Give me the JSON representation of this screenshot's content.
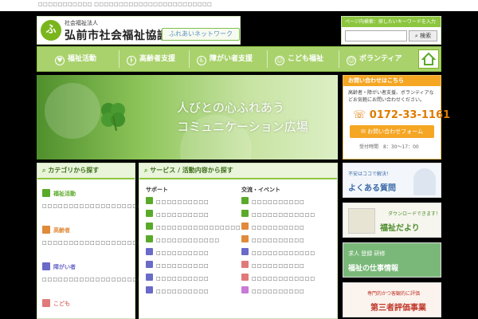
{
  "top_strip": {
    "text": "□□□□□□□□□□□ □□□□□□□□□□□□□□□□□□□□□□□□"
  },
  "header": {
    "logo_sub": "社会福祉法人",
    "logo_main": "弘前市社会福祉協議会",
    "logo_tag": "ふれあいネットワーク",
    "search_caption": "ページ内検索：探したいキーワードを入力",
    "search_placeholder": "",
    "search_button": "検索"
  },
  "nav": {
    "items": [
      {
        "label": "福祉活動",
        "icon": "heart-icon"
      },
      {
        "label": "高齢者支援",
        "icon": "elderly-icon"
      },
      {
        "label": "障がい者支援",
        "icon": "wheelchair-icon"
      },
      {
        "label": "こども福祉",
        "icon": "children-icon"
      },
      {
        "label": "ボランティア",
        "icon": "smile-icon"
      }
    ],
    "home_icon": "home-icon"
  },
  "hero": {
    "line1": "人びとの心ふれあう",
    "line2": "コミュニケーション広場"
  },
  "contact": {
    "title": "お問い合わせはこちら",
    "text": "高齢者・障がい者支援、ボランティアなどお気軽にお問い合わせください。",
    "phone": "0172-33-1161",
    "button": "お問い合わせフォーム",
    "hours": "受付時間　8：30～17：00"
  },
  "categories": {
    "title": "カテゴリから探す",
    "items": [
      {
        "label": "福祉活動",
        "color": "#5aaa2a",
        "desc": "□□□□□□□□□□□□□□□□□□□□□□□□□□□□□□□□"
      },
      {
        "label": "高齢者",
        "color": "#e08a3a",
        "desc": "□□□□□□□□□□□□□□□□□□□□□□□□□□□□□□□□"
      },
      {
        "label": "障がい者",
        "color": "#6a6ac8",
        "desc": "□□□□□□□□□□□□□□□□□□□□□□□□□□□□□□□□"
      },
      {
        "label": "こども",
        "color": "#e07a7a",
        "desc": "□□□□□□□□□□□□□□□□"
      }
    ]
  },
  "services": {
    "title": "サービス / 活動内容から探す",
    "col1_title": "サポート",
    "col2_title": "交流・イベント",
    "col1": [
      {
        "text": "□□□□□□□□□□",
        "color": "#5aaa2a"
      },
      {
        "text": "□□□□□□□□□□",
        "color": "#5aaa2a"
      },
      {
        "text": "□□□□□□□□□□□□□□□□",
        "color": "#5aaa2a"
      },
      {
        "text": "□□□□□□□□□□□□",
        "color": "#5aaa2a"
      },
      {
        "text": "□□□□□□□□□□",
        "color": "#6a6ac8"
      },
      {
        "text": "□□□□□□□□□□",
        "color": "#6a6ac8"
      },
      {
        "text": "□□□□□□□□□□",
        "color": "#6a6ac8"
      },
      {
        "text": "□□□□□□□□□□",
        "color": "#6a6ac8"
      }
    ],
    "col2": [
      {
        "text": "□□□□□□□□□□",
        "color": "#5aaa2a"
      },
      {
        "text": "□□□□□□□□□□□□",
        "color": "#5aaa2a"
      },
      {
        "text": "□□□□□□□□□□",
        "color": "#e08a3a"
      },
      {
        "text": "□□□□□□□□□□",
        "color": "#e08a3a"
      },
      {
        "text": "□□□□□□□□□□□□",
        "color": "#6a6ac8"
      },
      {
        "text": "□□□□□□□□□□",
        "color": "#e07a7a"
      },
      {
        "text": "□□□□□□□□□□□□",
        "color": "#e07a7a"
      },
      {
        "text": "□□□□□□□□□□",
        "color": "#c87ad8"
      }
    ]
  },
  "banners": [
    {
      "line1": "不安はココで解決！",
      "line2": "よくある質問",
      "color": "#3a6aa8"
    },
    {
      "line1": "ダウンロードできます！",
      "line2": "福祉だより",
      "color": "#4a8a2a"
    },
    {
      "line1": "求人 登録 研修",
      "line2": "福祉の仕事情報",
      "color": "#2a7a4a"
    },
    {
      "line1": "専門的かつ客観的に評価",
      "line2": "第三者評価事業",
      "color": "#c0392b"
    }
  ]
}
